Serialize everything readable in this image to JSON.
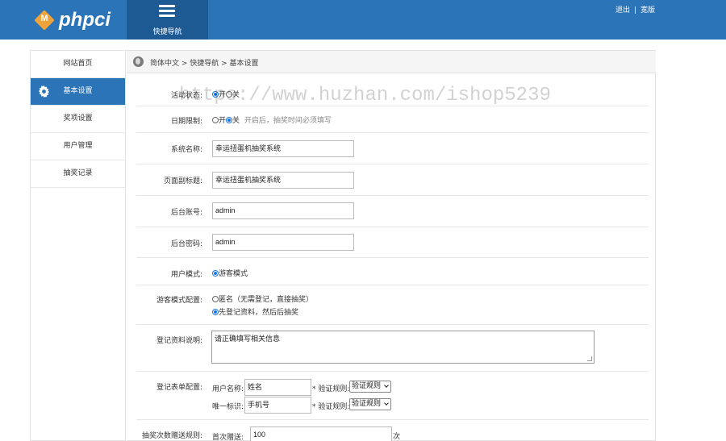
{
  "header": {
    "logo_letter": "M",
    "logo_text": "phpci",
    "quick_nav_label": "快捷导航",
    "logout_label": "退出",
    "theme_label": "宽版",
    "brand_color": "#2c74b8",
    "logo_color": "#f0a33a"
  },
  "sidebar": {
    "items": [
      {
        "label": "网站首页",
        "active": false
      },
      {
        "label": "基本设置",
        "active": true
      },
      {
        "label": "奖项设置",
        "active": false
      },
      {
        "label": "用户管理",
        "active": false
      },
      {
        "label": "抽奖记录",
        "active": false
      }
    ]
  },
  "breadcrumb": {
    "path": "简体中文 > 快捷导航 > 基本设置"
  },
  "watermark": "https://www.huzhan.com/ishop5239",
  "form": {
    "activity_status": {
      "label": "活动状态:",
      "opt_on": "开",
      "opt_off": "关",
      "selected": "开"
    },
    "date_limit": {
      "label": "日期限制:",
      "opt_on": "开",
      "opt_off": "关",
      "selected": "关",
      "hint": "开启后，抽奖时间必须填写"
    },
    "system_name": {
      "label": "系统名称:",
      "value": "幸运扭蛋机抽奖系统"
    },
    "page_subtitle": {
      "label": "页面副标题:",
      "value": "幸运扭蛋机抽奖系统"
    },
    "admin_account": {
      "label": "后台账号:",
      "value": "admin"
    },
    "admin_password": {
      "label": "后台密码:",
      "value": "admin"
    },
    "user_mode": {
      "label": "用户模式:",
      "option": "游客模式"
    },
    "guest_mode_config": {
      "label": "游客模式配置:",
      "opt_anonymous": "匿名（无需登记，直接抽奖）",
      "opt_register": "先登记资料，然后后抽奖",
      "selected": "先登记资料，然后后抽奖"
    },
    "register_desc": {
      "label": "登记资料说明:",
      "value": "请正确填写相关信息"
    },
    "register_form": {
      "label": "登记表单配置:",
      "rows": [
        {
          "field_label": "用户名称:",
          "value": "姓名",
          "rule_label": "* 验证规则:",
          "select_value": "验证规则"
        },
        {
          "field_label": "唯一标识:",
          "value": "手机号",
          "rule_label": "* 验证规则:",
          "select_value": "验证规则"
        }
      ]
    },
    "draw_rule": {
      "label": "抽奖次数赠送规则:",
      "first_label": "首次赠送:",
      "value": "100",
      "unit": "次"
    }
  }
}
